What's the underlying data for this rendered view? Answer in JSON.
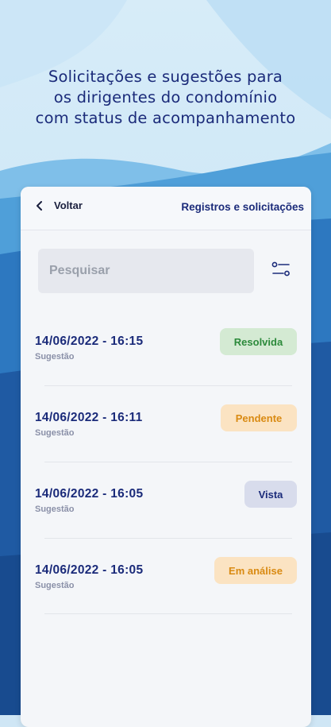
{
  "headline": {
    "line1": "Solicitações e sugestões para",
    "line2": "os dirigentes do condomínio",
    "line3": "com status de acompanhamento"
  },
  "header": {
    "back_label": "Voltar",
    "title": "Registros e solicitações"
  },
  "search": {
    "placeholder": "Pesquisar"
  },
  "records": [
    {
      "datetime": "14/06/2022 - 16:15",
      "type": "Sugestão",
      "status": "Resolvida"
    },
    {
      "datetime": "14/06/2022 - 16:11",
      "type": "Sugestão",
      "status": "Pendente"
    },
    {
      "datetime": "14/06/2022 - 16:05",
      "type": "Sugestão",
      "status": "Vista"
    },
    {
      "datetime": "14/06/2022 - 16:05",
      "type": "Sugestão",
      "status": "Em análise"
    }
  ],
  "colors": {
    "accent": "#1b2b7a",
    "resolvida_bg": "#d4ead3",
    "resolvida_text": "#2c8a3b",
    "pendente_bg": "#fbe3c2",
    "pendente_text": "#d98a12",
    "vista_bg": "#d8dcec",
    "vista_text": "#1b2b7a",
    "em_analise_bg": "#fbe3c2",
    "em_analise_text": "#d98a12"
  },
  "icons": {
    "back": "chevron-left-icon",
    "filter": "sliders-icon"
  }
}
